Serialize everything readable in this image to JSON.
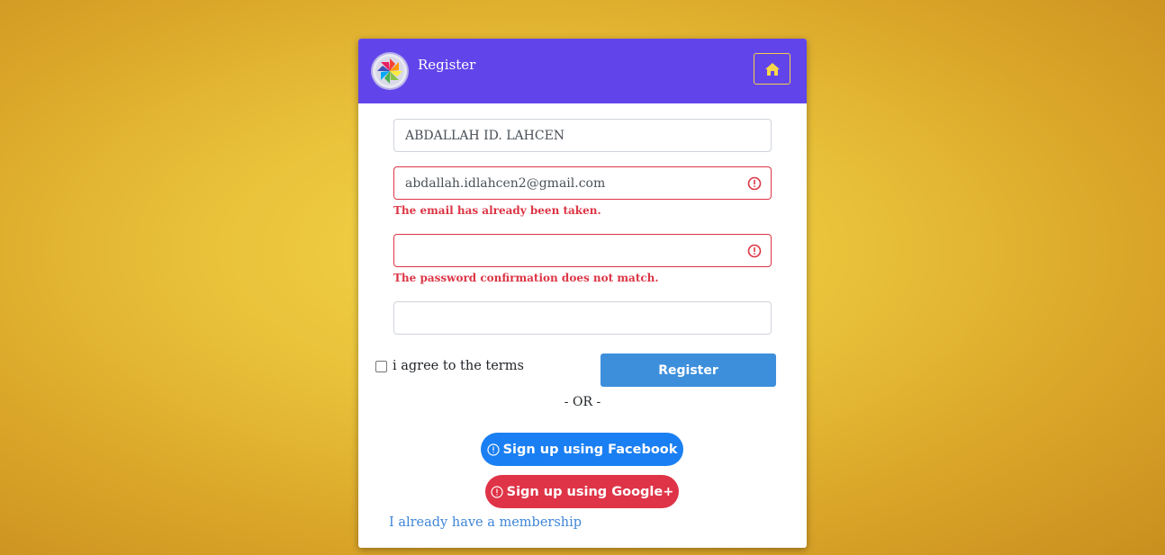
{
  "header": {
    "title": "Register",
    "home_icon": "home-icon"
  },
  "form": {
    "name_value": "ABDALLAH ID. LAHCEN",
    "email_value": "abdallah.idlahcen2@gmail.com",
    "email_error": "The email has already been taken.",
    "password_value": "",
    "password_error": "The password confirmation does not match.",
    "confirm_password_value": "",
    "terms_label": "i agree to the terms",
    "terms_checked": false,
    "register_label": "Register"
  },
  "social": {
    "separator": "- OR -",
    "facebook_label": "Sign up using Facebook",
    "google_label": "Sign up using Google+"
  },
  "footer": {
    "membership_link": "I already have a membership"
  },
  "colors": {
    "header": "#6245ea",
    "accent_yellow": "#f2d24a",
    "error": "#dc3545",
    "primary": "#3d8fdc",
    "facebook": "#1a7ff2",
    "google": "#df3447",
    "link": "#3f86d6"
  }
}
